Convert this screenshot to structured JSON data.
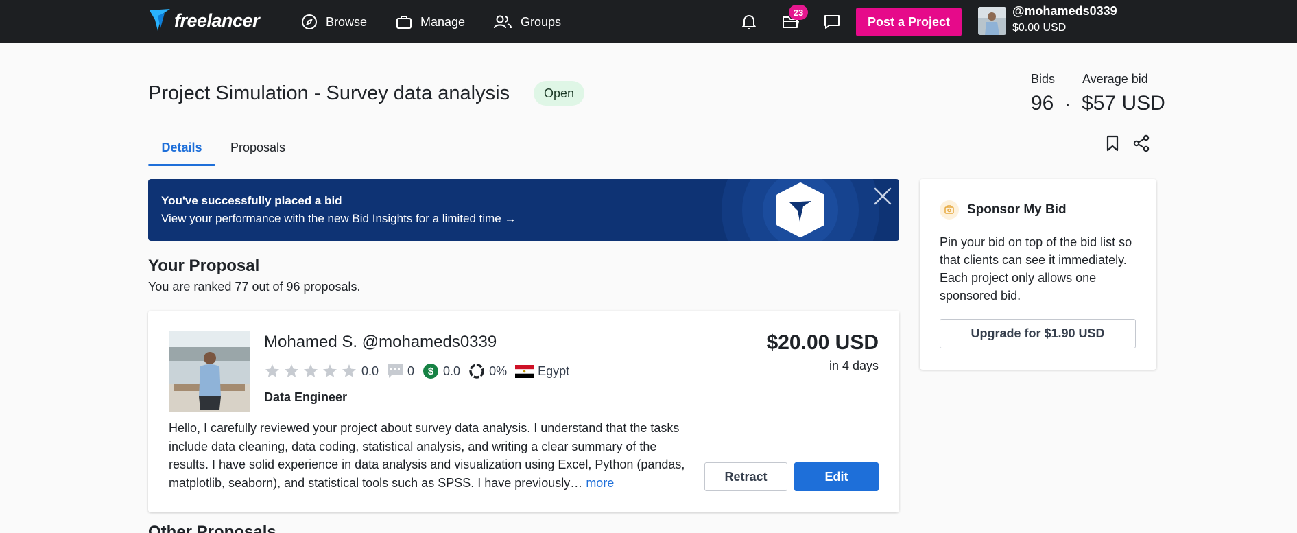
{
  "nav": {
    "logo_text": "freelancer",
    "browse": "Browse",
    "manage": "Manage",
    "groups": "Groups",
    "notification_count": "23",
    "post_project": "Post a Project",
    "username": "@mohameds0339",
    "balance": "$0.00 USD"
  },
  "project": {
    "title": "Project Simulation - Survey data analysis",
    "status": "Open",
    "bids_label": "Bids",
    "avg_label": "Average bid",
    "bids_value": "96",
    "separator": "·",
    "avg_value": "$57 USD"
  },
  "tabs": [
    "Details",
    "Proposals"
  ],
  "banner": {
    "title": "You've successfully placed a bid",
    "subtitle": "View your performance with the new Bid Insights for a limited time →"
  },
  "your_proposal": {
    "heading": "Your Proposal",
    "rank_text": "You are ranked 77 out of 96 proposals."
  },
  "proposal": {
    "name": "Mohamed S. @mohameds0339",
    "rating": "0.0",
    "stars_filled": 0,
    "reviews": "0",
    "earnings": "0.0",
    "completion": "0%",
    "country": "Egypt",
    "role": "Data Engineer",
    "text": "Hello, I carefully reviewed your project about survey data analysis. I understand that the tasks include data cleaning, data coding, statistical analysis, and writing a clear summary of the results. I have solid experience in data analysis and visualization using Excel, Python (pandas, matplotlib, seaborn), and statistical tools such as SPSS. I have previously…",
    "more": "more",
    "price": "$20.00 USD",
    "days": "in 4 days",
    "retract": "Retract",
    "edit": "Edit"
  },
  "other_proposals": {
    "heading": "Other Proposals"
  },
  "sponsor": {
    "title": "Sponsor My Bid",
    "text": "Pin your bid on top of the bid list so that clients can see it immediately. Each project only allows one sponsored bid.",
    "button": "Upgrade for $1.90 USD"
  },
  "colors": {
    "nav_bg": "#1d1f22",
    "accent_blue": "#1e6fd9",
    "pink": "#e60a8a",
    "banner_bg": "#0e3374",
    "status_green_bg": "#dff6e6"
  }
}
